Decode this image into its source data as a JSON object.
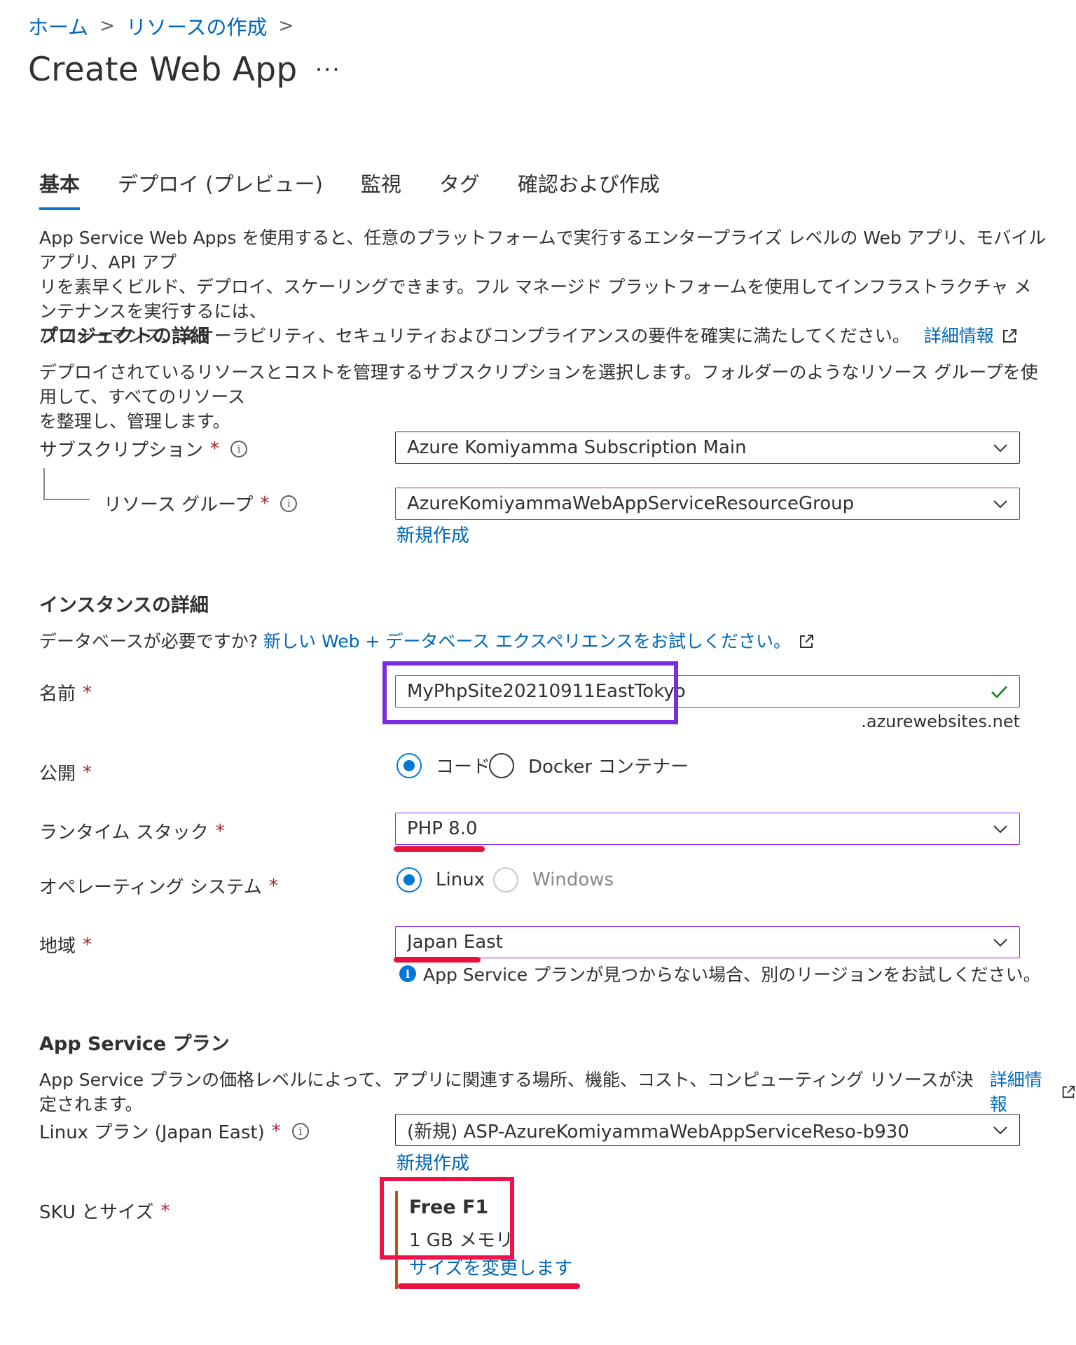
{
  "breadcrumb": {
    "home": "ホーム",
    "create_resource": "リソースの作成",
    "sep": ">"
  },
  "title": "Create Web App",
  "more": "···",
  "tabs": [
    "基本",
    "デプロイ (プレビュー)",
    "監視",
    "タグ",
    "確認および作成"
  ],
  "intro": {
    "line1": "App Service Web Apps を使用すると、任意のプラットフォームで実行するエンタープライズ レベルの Web アプリ、モバイル アプリ、API アプ",
    "line2": "リを素早くビルド、デプロイ、スケーリングできます。フル マネージド プラットフォームを使用してインフラストラクチャ メンテナンスを実行するには、",
    "line3": "パフォーマンス、スケーラビリティ、セキュリティおよびコンプライアンスの要件を確実に満たしてください。",
    "link": "詳細情報"
  },
  "project": {
    "heading": "プロジェクトの詳細",
    "desc1": "デプロイされているリソースとコストを管理するサブスクリプションを選択します。フォルダーのようなリソース グループを使用して、すべてのリソース",
    "desc2": "を整理し、管理します。",
    "subscription_label": "サブスクリプション",
    "subscription_value": "Azure Komiyamma Subscription Main",
    "rg_label": "リソース グループ",
    "rg_value": "AzureKomiyammaWebAppServiceResourceGroup",
    "create_new": "新規作成"
  },
  "instance": {
    "heading": "インスタンスの詳細",
    "db_prompt": "データベースが必要ですか?",
    "db_link": "新しい Web + データベース エクスペリエンスをお試しください。",
    "name_label": "名前",
    "name_value": "MyPhpSite20210911EastTokyo",
    "domain_suffix": ".azurewebsites.net",
    "publish_label": "公開",
    "publish_code": "コード",
    "publish_docker": "Docker コンテナー",
    "runtime_label": "ランタイム スタック",
    "runtime_value": "PHP 8.0",
    "os_label": "オペレーティング システム",
    "os_linux": "Linux",
    "os_windows": "Windows",
    "region_label": "地域",
    "region_value": "Japan East",
    "region_info": "App Service プランが見つからない場合、別のリージョンをお試しください。"
  },
  "plan": {
    "heading": "App Service プラン",
    "desc": "App Service プランの価格レベルによって、アプリに関連する場所、機能、コスト、コンピューティング リソースが決定されます。",
    "link": "詳細情報",
    "linux_plan_label": "Linux プラン (Japan East)",
    "linux_plan_value": "(新規) ASP-AzureKomiyammaWebAppServiceReso-b930",
    "create_new": "新規作成",
    "sku_label": "SKU とサイズ",
    "sku_name": "Free F1",
    "sku_memory": "1 GB メモリ",
    "sku_change": "サイズを変更します"
  },
  "required_mark": "*",
  "info_glyph": "i",
  "colors": {
    "accent": "#0078d4",
    "link": "#0067b8",
    "required": "#a4262c",
    "valid": "#107c10",
    "annotation_purple": "#7b2be2",
    "annotation_red": "#f4114a",
    "sku_bar": "#ca5010"
  }
}
